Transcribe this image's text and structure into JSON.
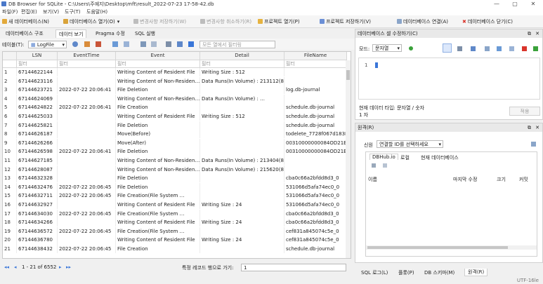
{
  "window": {
    "title": "DB Browser for SQLite - C:\\Users\\주예지\\Desktop\\mft\\result_2022-07-23 17-58-42.db",
    "minimize": "—",
    "maximize": "▢",
    "close": "✕"
  },
  "menu": [
    "파일(F)",
    "편집(E)",
    "보기(V)",
    "도구(T)",
    "도움말(H)"
  ],
  "toolbar": {
    "new_db": "새 데이터베이스(N)",
    "open_db": "데이터베이스 열기(O)",
    "write_changes": "변경사항 저장하기(W)",
    "revert_changes": "변경사항 취소하기(R)",
    "open_project": "프로젝트 열기(P)",
    "save_project": "프로젝트 저장하기(V)",
    "attach_db": "데이터베이스 연결(A)",
    "close_db": "데이터베이스 닫기(C)"
  },
  "tabs": [
    "데이터베이스 구조",
    "데이터 보기",
    "Pragma 수정",
    "SQL 실행"
  ],
  "table_selector": {
    "label": "테이블(T):",
    "value": "LogFile",
    "filter_placeholder": "모든 열에서 필터링"
  },
  "grid": {
    "columns": [
      "",
      "LSN",
      "EventTime",
      "Event",
      "Detail",
      "FileName"
    ],
    "filter_placeholder": "필터",
    "rows": [
      [
        "1",
        "67144622144",
        "",
        "Writing Content of Resident File",
        "Writing Size : 512",
        ""
      ],
      [
        "2",
        "67144623116",
        "",
        "Writing Content of Non-Residen…",
        "Data Runs(In Volume) : 213112(8)",
        ""
      ],
      [
        "3",
        "67144623721",
        "2022-07-22 20:06:41",
        "File Deletion",
        "",
        "log.db-journal"
      ],
      [
        "4",
        "67144624069",
        "",
        "Writing Content of Non-Residen…",
        "Data Runs(In Volume) : …",
        ""
      ],
      [
        "5",
        "67144624822",
        "2022-07-22 20:06:41",
        "File Creation",
        "",
        "schedule.db-journal"
      ],
      [
        "6",
        "67144625033",
        "",
        "Writing Content of Resident File",
        "Writing Size : 512",
        "schedule.db-journal"
      ],
      [
        "7",
        "67144625821",
        "",
        "File Deletion",
        "",
        "schedule.db-journal"
      ],
      [
        "8",
        "67144626187",
        "",
        "Move(Before)",
        "",
        "todelete_7728f067d183E"
      ],
      [
        "9",
        "67144626266",
        "",
        "Move(After)",
        "",
        "00310000000084OD21E"
      ],
      [
        "10",
        "67144626598",
        "2022-07-22 20:06:41",
        "File Deletion",
        "",
        "00310000000084OD21E"
      ],
      [
        "11",
        "67144627185",
        "",
        "Writing Content of Non-Residen…",
        "Data Runs(In Volume) : 213404(8)",
        ""
      ],
      [
        "12",
        "67144628087",
        "",
        "Writing Content of Non-Residen…",
        "Data Runs(In Volume) : 215620(8)",
        ""
      ],
      [
        "13",
        "67144632328",
        "",
        "File Deletion",
        "",
        "cba0c66a2bfdd8d3_0"
      ],
      [
        "14",
        "67144632476",
        "2022-07-22 20:06:45",
        "File Deletion",
        "",
        "531066d5afa74ec0_0"
      ],
      [
        "15",
        "67144632711",
        "2022-07-22 20:06:45",
        "File Creation(File System …",
        "",
        "531066d5afa74ec0_0"
      ],
      [
        "16",
        "67144632927",
        "",
        "Writing Content of Resident File",
        "Writing Size : 24",
        "531066d5afa74ec0_0"
      ],
      [
        "17",
        "67144634030",
        "2022-07-22 20:06:45",
        "File Creation(File System …",
        "",
        "cba0c66a2bfdd8d3_0"
      ],
      [
        "18",
        "67144634266",
        "",
        "Writing Content of Resident File",
        "Writing Size : 24",
        "cba0c66a2bfdd8d3_0"
      ],
      [
        "19",
        "67144636572",
        "2022-07-22 20:06:45",
        "File Creation(File System …",
        "",
        "cef831a845074c5e_0"
      ],
      [
        "20",
        "67144636780",
        "",
        "Writing Content of Resident File",
        "Writing Size : 24",
        "cef831a845074c5e_0"
      ],
      [
        "21",
        "67144638432",
        "2022-07-22 20:06:45",
        "File Creation",
        "",
        "schedule.db-journal"
      ]
    ]
  },
  "nav": {
    "first": "◂◂",
    "prev": "◂",
    "range": "1 - 21 of 6552",
    "next": "▸",
    "last": "▸▸",
    "goto_label": "특정 레코드 행으로 가기:",
    "goto_value": "1"
  },
  "edit_panel": {
    "title": "데이터베이스 셀 수정하기(C)",
    "mode_label": "모드:",
    "mode_value": "문자열",
    "line_number": "1",
    "data_type_label": "현재 데이터 타입: 문자열 / 숫자",
    "size_label": "1 자",
    "apply": "적용"
  },
  "remote_panel": {
    "title": "원격(R)",
    "identity_label": "신원",
    "identity_value": "연결할 ID를 선택하세요",
    "tabs": [
      "DBHub.io",
      "로컬",
      "현재 데이터베이스"
    ],
    "columns": [
      "이름",
      "마지막 수정",
      "크기",
      "커밋"
    ]
  },
  "bottom_tabs": [
    "SQL 로그(L)",
    "플롯(P)",
    "DB 스키마(M)",
    "원격(R)"
  ],
  "encoding": "UTF-16le",
  "colors": {
    "accent": "#3a76d8",
    "close_red": "#d9342b",
    "green": "#3aa13a"
  }
}
